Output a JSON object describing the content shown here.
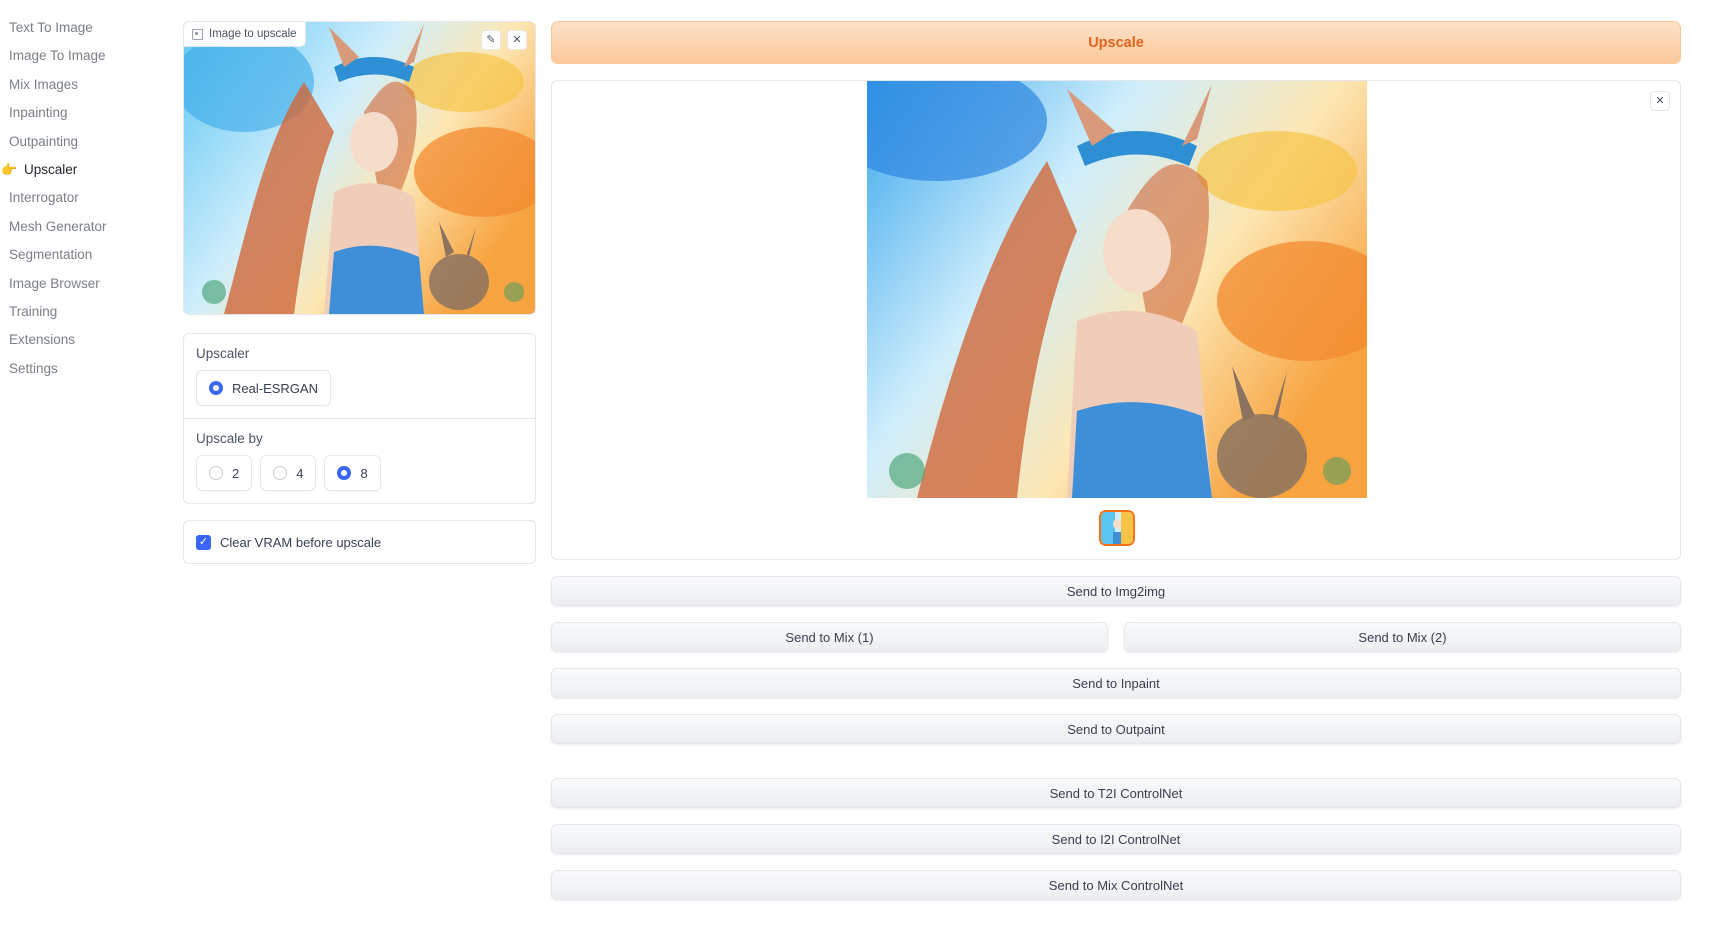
{
  "sidebar": {
    "items": [
      {
        "label": "Text To Image"
      },
      {
        "label": "Image To Image"
      },
      {
        "label": "Mix Images"
      },
      {
        "label": "Inpainting"
      },
      {
        "label": "Outpainting"
      },
      {
        "label": "Upscaler",
        "active": true,
        "icon": "pointing-hand-icon",
        "icon_glyph": "👉"
      },
      {
        "label": "Interrogator"
      },
      {
        "label": "Mesh Generator"
      },
      {
        "label": "Segmentation"
      },
      {
        "label": "Image Browser"
      },
      {
        "label": "Training"
      },
      {
        "label": "Extensions"
      },
      {
        "label": "Settings"
      }
    ]
  },
  "input_image": {
    "label": "Image to upscale",
    "edit_glyph": "✎",
    "close_glyph": "✕"
  },
  "upscaler": {
    "title": "Upscaler",
    "options": [
      {
        "label": "Real-ESRGAN",
        "selected": true
      }
    ]
  },
  "upscale_by": {
    "title": "Upscale by",
    "options": [
      {
        "label": "2",
        "selected": false
      },
      {
        "label": "4",
        "selected": false
      },
      {
        "label": "8",
        "selected": true
      }
    ]
  },
  "clear_vram": {
    "label": "Clear VRAM before upscale",
    "checked": true,
    "check_glyph": "✓"
  },
  "actions": {
    "upscale_label": "Upscale",
    "send_img2img": "Send to Img2img",
    "send_mix_1": "Send to Mix (1)",
    "send_mix_2": "Send to Mix (2)",
    "send_inpaint": "Send to Inpaint",
    "send_outpaint": "Send to Outpaint",
    "send_t2i_controlnet": "Send to T2I ControlNet",
    "send_i2i_controlnet": "Send to I2I ControlNet",
    "send_mix_controlnet": "Send to Mix ControlNet"
  },
  "gallery": {
    "close_glyph": "✕"
  },
  "colors": {
    "accent": "#3b66f5",
    "primary_text": "#e5631a",
    "primary_bg": "#fcc89b",
    "thumb_border": "#f97316"
  }
}
